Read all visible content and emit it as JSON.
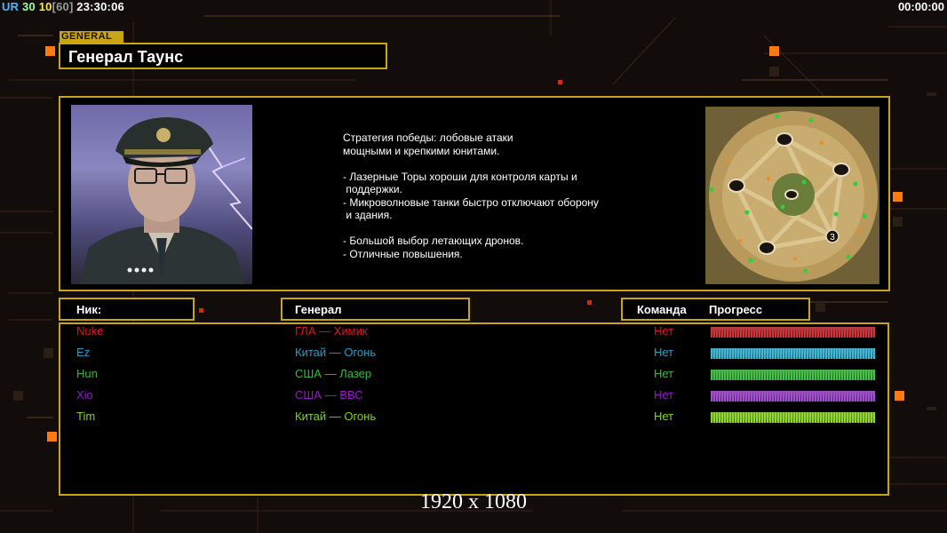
{
  "hud": {
    "ur": "UR",
    "n30": "30",
    "n10": "10",
    "n60": "[60]",
    "clock": "23:30:06",
    "timer": "00:00:00"
  },
  "general": {
    "tag": "GENERAL",
    "name": "Генерал Таунс",
    "description": "Стратегия победы: лобовые атаки\nмощными и крепкими юнитами.\n\n- Лазерные Торы хороши для контроля карты и\n поддержки.\n- Микроволновые танки быстро отключают оборону\n и здания.\n\n- Большой выбор летающих дронов.\n- Отличные повышения."
  },
  "minimap": {
    "label_3": "3"
  },
  "headers": {
    "nick": "Ник:",
    "general": "Генерал",
    "team": "Команда",
    "progress": "Прогресс"
  },
  "players": [
    {
      "nick": "Nuke",
      "general": "ГЛА — Химик",
      "team": "Нет",
      "color": "#e0161a",
      "bar": "#c8353a",
      "progress": 1.0
    },
    {
      "nick": "Ez",
      "general": "Китай — Огонь",
      "team": "Нет",
      "color": "#2a9cc4",
      "bar": "#3fb7d6",
      "progress": 1.0
    },
    {
      "nick": "Hun",
      "general": "США — Лазер",
      "team": "Нет",
      "color": "#3bb83b",
      "bar": "#45c046",
      "progress": 1.0
    },
    {
      "nick": "Xio",
      "general": "США — ВВС",
      "team": "Нет",
      "color": "#9a18c8",
      "bar": "#a14fd0",
      "progress": 1.0
    },
    {
      "nick": "Tim",
      "general": "Китай — Огонь",
      "team": "Нет",
      "color": "#7ed321",
      "bar": "#8fd630",
      "progress": 1.0
    }
  ],
  "footer": {
    "resolution": "1920 x 1080"
  },
  "colors": {
    "accent_gold": "#c9a414",
    "square_orange": "#ff7a10"
  }
}
